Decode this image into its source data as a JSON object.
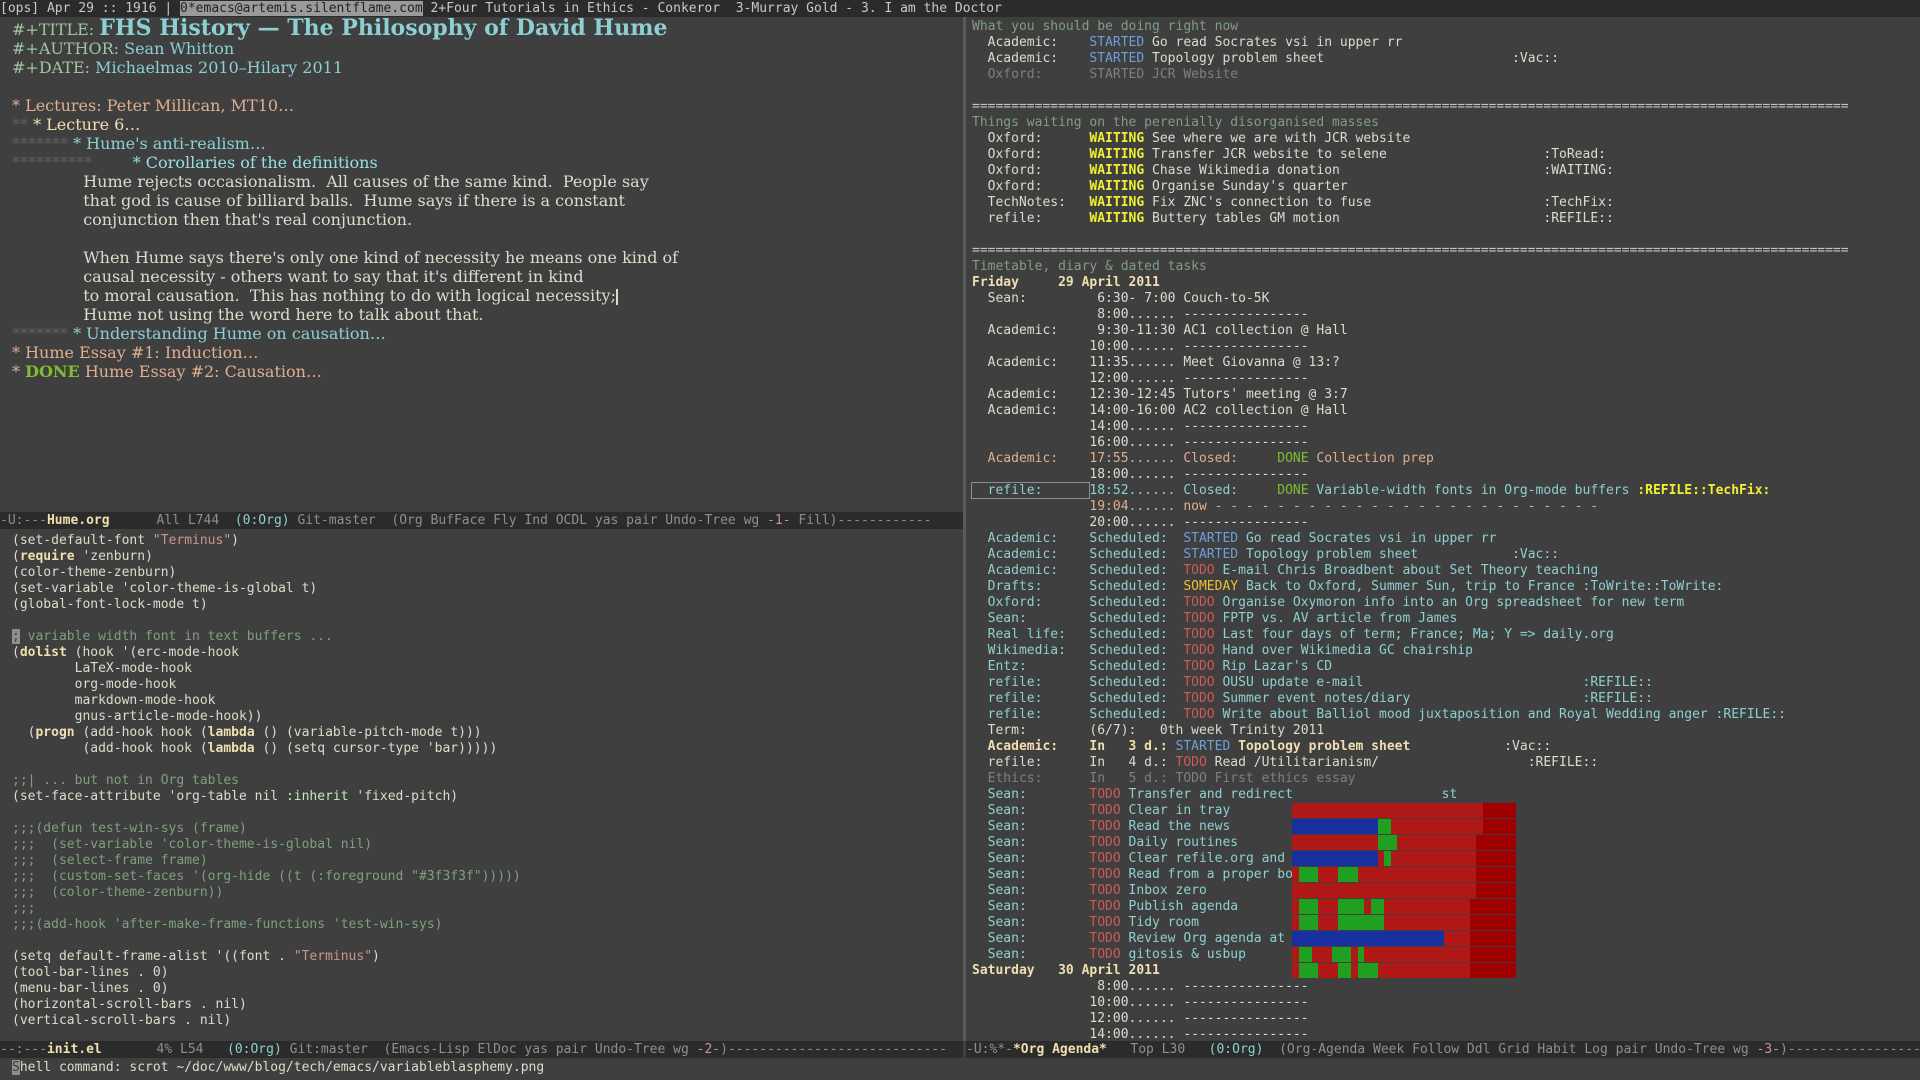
{
  "topbar": {
    "left": "[ops] Apr 29 :: 1916 |",
    "current": "0*emacs@artemis.silentflame.com",
    "tab2": "2+Four Tutorials in Ethics - Conkeror",
    "tab3": "3-Murray Gold - 3. I am the Doctor"
  },
  "hume": {
    "title_kw": "#+TITLE: ",
    "title": "FHS History — The Philosophy of David Hume",
    "author_kw": "#+AUTHOR: ",
    "author": "Sean Whitton",
    "date_kw": "#+DATE: ",
    "date": "Michaelmas 2010–Hilary 2011",
    "h_lectures": "* Lectures: Peter Millican, MT10…",
    "h_lecture6_stars": "** ",
    "h_lecture6": "* Lecture 6…",
    "h_antirealism_stars": "******* ",
    "h_antirealism": "* Hume's anti-realism…",
    "h_corollaries_stars": "********** ",
    "h_corollaries": "* Corollaries of the definitions",
    "p1_l1": "Hume rejects occasionalism.  All causes of the same kind.  People say",
    "p1_l2": "that god is cause of billiard balls.  Hume says if there is a constant",
    "p1_l3": "conjunction then that's real conjunction.",
    "p2_l1": "When Hume says there's only one kind of necessity he means one kind of",
    "p2_l2": "causal necessity - others want to say that it's different in kind",
    "p2_l3": "to moral causation.  This has nothing to do with logical necessity;",
    "p2_l4": "Hume not using the word here to talk about that.",
    "h_understanding_stars": "******* ",
    "h_understanding": "* Understanding Hume on causation…",
    "h_essay1": "* Hume Essay #1: Induction…",
    "h_essay2_star": "* ",
    "h_essay2_done": "DONE",
    "h_essay2": " Hume Essay #2: Causation…"
  },
  "ml_hume": {
    "pre": "-U:---",
    "buf": "Hume.org",
    "mid": "      All L744  ",
    "mode": "(0:Org)",
    "post": " Git-master  (Org BufFace Fly Ind OCDL yas pair Undo-Tree wg ",
    "red": "-1-",
    "end": " Fill)------------"
  },
  "init": [
    [
      "(set-default-font ",
      "\"Terminus\"",
      ")"
    ],
    [
      "(",
      "require",
      " 'zenburn)"
    ],
    [
      "(color-theme-zenburn)"
    ],
    [
      "(set-variable 'color-theme-is-global t)"
    ],
    [
      "(global-font-lock-mode t)"
    ],
    [
      ""
    ],
    [
      "; variable width font in text buffers ..."
    ],
    [
      "(",
      "dolist",
      " (hook '(erc-mode-hook"
    ],
    [
      "        LaTeX-mode-hook"
    ],
    [
      "        org-mode-hook"
    ],
    [
      "        markdown-mode-hook"
    ],
    [
      "        gnus-article-mode-hook))"
    ],
    [
      "  (",
      "progn",
      " (add-hook hook (",
      "lambda",
      " () (variable-pitch-mode t)))"
    ],
    [
      "         (add-hook hook (",
      "lambda",
      " () (setq cursor-type 'bar)))))"
    ],
    [
      ""
    ],
    [
      ";;| ... but not in Org tables"
    ],
    [
      "(set-face-attribute 'org-table nil ",
      ":inherit",
      " 'fixed-pitch)"
    ],
    [
      ""
    ],
    [
      ";;;(defun test-win-sys (frame)"
    ],
    [
      ";;;  (set-variable 'color-theme-is-global nil)"
    ],
    [
      ";;;  (select-frame frame)"
    ],
    [
      ";;;  (custom-set-faces '(org-hide ((t (:foreground \"#3f3f3f\")))))"
    ],
    [
      ";;;  (color-theme-zenburn))"
    ],
    [
      ";;;"
    ],
    [
      ";;;(add-hook 'after-make-frame-functions 'test-win-sys)"
    ],
    [
      ""
    ],
    [
      "(setq default-frame-alist '((font . ",
      "\"Terminus\"",
      ")"
    ],
    [
      "(tool-bar-lines . 0)"
    ],
    [
      "(menu-bar-lines . 0)"
    ],
    [
      "(horizontal-scroll-bars . nil)"
    ],
    [
      "(vertical-scroll-bars . nil)"
    ]
  ],
  "ml_init": {
    "pre": "--:---",
    "buf": "init.el",
    "mid": "       4% L54   ",
    "mode": "(0:Org)",
    "post": " Git:master  (Emacs-Lisp ElDoc yas pair Undo-Tree wg ",
    "red": "-2-",
    ")": ")----------------------------"
  },
  "agenda": {
    "sec1": "What you should be doing right now",
    "now_rows": [
      [
        "  Academic:    ",
        "STARTED",
        " Go read Socrates vsi in upper rr",
        ""
      ],
      [
        "  Academic:    ",
        "STARTED",
        " Topology problem sheet",
        "                        :Vac::"
      ],
      [
        "  Oxford:      ",
        "STARTED",
        " JCR Website",
        ""
      ]
    ],
    "rule": "================================================================================================================",
    "sec2": "Things waiting on the perenially disorganised masses",
    "wait_rows": [
      [
        "  Oxford:      ",
        "WAITING",
        " See where we are with JCR website",
        ""
      ],
      [
        "  Oxford:      ",
        "WAITING",
        " Transfer JCR website to selene",
        "                    :ToRead:"
      ],
      [
        "  Oxford:      ",
        "WAITING",
        " Chase Wikimedia donation",
        "                          :WAITING:"
      ],
      [
        "  Oxford:      ",
        "WAITING",
        " Organise Sunday's quarter",
        ""
      ],
      [
        "  TechNotes:   ",
        "WAITING",
        " Fix ZNC's connection to fuse",
        "                      :TechFix:"
      ],
      [
        "  refile:      ",
        "WAITING",
        " Buttery tables GM motion",
        "                          :REFILE::"
      ]
    ],
    "sec3": "Timetable, diary & dated tasks",
    "day1": "Friday     29 April 2011",
    "timetable": [
      [
        "  Sean:         ",
        "6:30- 7:00 Couch-to-5K"
      ],
      [
        "                ",
        "8:00...... ----------------"
      ],
      [
        "  Academic:     ",
        "9:30-11:30 AC1 collection @ Hall"
      ],
      [
        "               ",
        "10:00...... ----------------"
      ],
      [
        "  Academic:    ",
        "11:35...... Meet Giovanna @ 13:?"
      ],
      [
        "               ",
        "12:00...... ----------------"
      ],
      [
        "  Academic:    ",
        "12:30-12:45 Tutors' meeting @ 3:7"
      ],
      [
        "  Academic:    ",
        "14:00-16:00 AC2 collection @ Hall"
      ],
      [
        "               ",
        "14:00...... ----------------"
      ],
      [
        "               ",
        "16:00...... ----------------"
      ]
    ],
    "closed1": [
      "  Academic:    ",
      "17:55...... Closed:     ",
      "DONE",
      " Collection prep"
    ],
    "t1800": "               18:00...... ----------------",
    "closed2": [
      "  refile:      ",
      "18:52...... Closed:     ",
      "DONE",
      " Variable-width fonts in Org-mode buffers ",
      ":REFILE::TechFix:"
    ],
    "nowline": "               19:04...... now - - - - - - - - - - - - - - - - - - - - - - - - -",
    "t2000": "               20:00...... ----------------",
    "sched_rows": [
      [
        "  Academic:    Scheduled:  ",
        "STARTED",
        " Go read Socrates vsi in upper rr",
        ""
      ],
      [
        "  Academic:    Scheduled:  ",
        "STARTED",
        " Topology problem sheet",
        "            :Vac::"
      ],
      [
        "  Academic:    Scheduled:  ",
        "TODO",
        " E-mail Chris Broadbent about Set Theory teaching",
        ""
      ],
      [
        "  Drafts:      Scheduled:  ",
        "SOMEDAY",
        " Back to Oxford, Summer Sun, trip to France ",
        ":ToWrite::ToWrite:"
      ],
      [
        "  Oxford:      Scheduled:  ",
        "TODO",
        " Organise Oxymoron info into an Org spreadsheet for new term",
        ""
      ],
      [
        "  Sean:        Scheduled:  ",
        "TODO",
        " FPTP vs. AV article from James",
        ""
      ],
      [
        "  Real life:   Scheduled:  ",
        "TODO",
        " Last four days of term; France; Ma; Y => daily.org",
        ""
      ],
      [
        "  Wikimedia:   Scheduled:  ",
        "TODO",
        " Hand over Wikimedia GC chairship",
        ""
      ],
      [
        "  Entz:        Scheduled:  ",
        "TODO",
        " Rip Lazar's CD",
        ""
      ],
      [
        "  refile:      Scheduled:  ",
        "TODO",
        " OUSU update e-mail",
        "                            :REFILE::"
      ],
      [
        "  refile:      Scheduled:  ",
        "TODO",
        " Summer event notes/diary",
        "                      :REFILE::"
      ],
      [
        "  refile:      Scheduled:  ",
        "TODO",
        " Write about Balliol mood juxtaposition and Royal Wedding anger ",
        ":REFILE::"
      ]
    ],
    "term": "  Term:        (6/7):   0th week Trinity 2011",
    "in1": [
      "  Academic:    In   3 d.: ",
      "STARTED",
      " Topology problem sheet",
      "            :Vac::"
    ],
    "in2": [
      "  refile:      In   4 d.: ",
      "TODO",
      " Read /Utilitarianism/",
      "                   :REFILE::"
    ],
    "in3": "  Ethics:      In   5 d.: TODO First ethics essay",
    "habits": [
      [
        "  Sean:        ",
        "TODO",
        " Transfer and redirect",
        "                   st"
      ],
      [
        "  Sean:        ",
        "TODO",
        " Clear in tray",
        ""
      ],
      [
        "  Sean:        ",
        "TODO",
        " Read the news",
        ""
      ],
      [
        "  Sean:        ",
        "TODO",
        " Daily routines",
        ""
      ],
      [
        "  Sean:        ",
        "TODO",
        " Clear refile.org and",
        ""
      ],
      [
        "  Sean:        ",
        "TODO",
        " Read from a proper bo",
        ""
      ],
      [
        "  Sean:        ",
        "TODO",
        " Inbox zero",
        ""
      ],
      [
        "  Sean:        ",
        "TODO",
        " Publish agenda",
        ""
      ],
      [
        "  Sean:        ",
        "TODO",
        " Tidy room",
        ""
      ],
      [
        "  Sean:        ",
        "TODO",
        " Review Org agenda at",
        ""
      ],
      [
        "  Sean:        ",
        "TODO",
        " gitosis & usbup",
        ""
      ]
    ],
    "day2": "Saturday   30 April 2011",
    "sat": [
      "                8:00...... ----------------",
      "               10:00...... ----------------",
      "               12:00...... ----------------",
      "               14:00...... ----------------"
    ]
  },
  "ml_agenda": {
    "pre": "-U:%*-",
    "buf": "*Org Agenda*",
    "mid": "   Top L30   ",
    "mode": "(0:Org)",
    "post": "  (Org-Agenda Week Follow Ddl Grid Habit Log pair Undo-Tree wg ",
    "red": "-3-",
    "end": ")------------------"
  },
  "minibuffer": "Shell command: scrot ~/doc/www/blog/tech/emacs/variableblasphemy.png"
}
